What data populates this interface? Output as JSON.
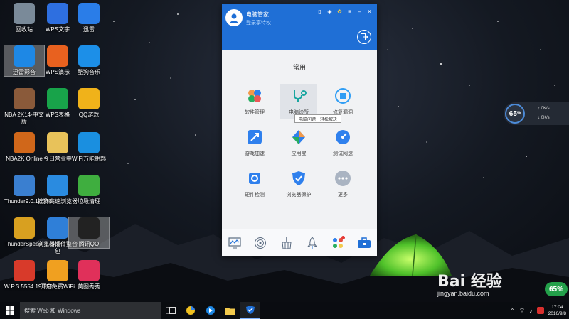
{
  "desktop_icons": [
    {
      "label": "回收站",
      "icon": "recycle-bin-icon",
      "color": "#7a8a99"
    },
    {
      "label": "WPS文字",
      "icon": "wps-writer-icon",
      "color": "#2e6fe0"
    },
    {
      "label": "迅雷",
      "icon": "thunder-icon",
      "color": "#2a7de8"
    },
    {
      "label": "迅雷影音",
      "icon": "thunder-player-icon",
      "color": "#1e88e5"
    },
    {
      "label": "WPS演示",
      "icon": "wps-presentation-icon",
      "color": "#e8611f"
    },
    {
      "label": "酷狗音乐",
      "icon": "kugou-icon",
      "color": "#1c8fe8"
    },
    {
      "label": "NBA 2K14-中文版",
      "icon": "nba2k14-icon",
      "color": "#8a5a3a"
    },
    {
      "label": "WPS表格",
      "icon": "wps-spreadsheet-icon",
      "color": "#18a34a"
    },
    {
      "label": "QQ游戏",
      "icon": "qq-games-icon",
      "color": "#f0b21a"
    },
    {
      "label": "NBA2K Online",
      "icon": "nba2k-online-icon",
      "color": "#d0671a"
    },
    {
      "label": "今日营业中",
      "icon": "folder-icon",
      "color": "#e8c25a"
    },
    {
      "label": "WiFi万能钥匙",
      "icon": "wifi-key-icon",
      "color": "#1a8fe0"
    },
    {
      "label": "Thunder9.0.11.318",
      "icon": "thunder-installer-icon",
      "color": "#3a7fd0"
    },
    {
      "label": "搜狗高速浏览器",
      "icon": "sogou-browser-icon",
      "color": "#2a8be0"
    },
    {
      "label": "垃圾清理",
      "icon": "trash-clean-icon",
      "color": "#3fae3f"
    },
    {
      "label": "ThunderSpeed_1.0.33...",
      "icon": "thunder-speed-icon",
      "color": "#d8a020"
    },
    {
      "label": "浏览器插件整合包",
      "icon": "plugin-pack-icon",
      "color": "#2f7fd8"
    },
    {
      "label": "腾讯QQ",
      "icon": "qq-icon",
      "color": "#222222"
    },
    {
      "label": "W.P.S.5554.19.358",
      "icon": "wps-installer-icon",
      "color": "#d83a2a"
    },
    {
      "label": "开启免费WiFi",
      "icon": "free-wifi-icon",
      "color": "#f0a020"
    },
    {
      "label": "美图秀秀",
      "icon": "meitu-icon",
      "color": "#e0305a"
    }
  ],
  "window": {
    "title": "电脑管家",
    "login_link": "登录享特权",
    "section": "常用",
    "tiles": [
      {
        "label": "软件管理",
        "icon": "software-manager-icon"
      },
      {
        "label": "电脑诊所",
        "icon": "stethoscope-icon"
      },
      {
        "label": "修复漏洞",
        "icon": "patch-icon"
      },
      {
        "label": "游戏加速",
        "icon": "game-boost-icon"
      },
      {
        "label": "应用宝",
        "icon": "app-store-icon"
      },
      {
        "label": "测试网速",
        "icon": "speed-test-icon"
      },
      {
        "label": "硬件检测",
        "icon": "hardware-check-icon"
      },
      {
        "label": "浏览器保护",
        "icon": "browser-shield-icon"
      },
      {
        "label": "更多",
        "icon": "more-icon"
      }
    ],
    "tooltip": "电脑问题，轻松解决",
    "footer_icons": [
      "monitor-icon",
      "target-icon",
      "broom-icon",
      "rocket-icon",
      "grid-apps-icon",
      "toolbox-icon"
    ],
    "accent": "#1f6fd6"
  },
  "speed_widget": {
    "percent": "65",
    "unit": "%",
    "upload": "0K/s",
    "download": "0K/s"
  },
  "taskbar": {
    "search_placeholder": "搜索 Web 和 Windows",
    "time": "17:04",
    "date": "2016/9/8"
  },
  "corner_badge": "65%",
  "watermark": {
    "brand": "Bai  经验",
    "site": "jingyan.baidu.com"
  }
}
